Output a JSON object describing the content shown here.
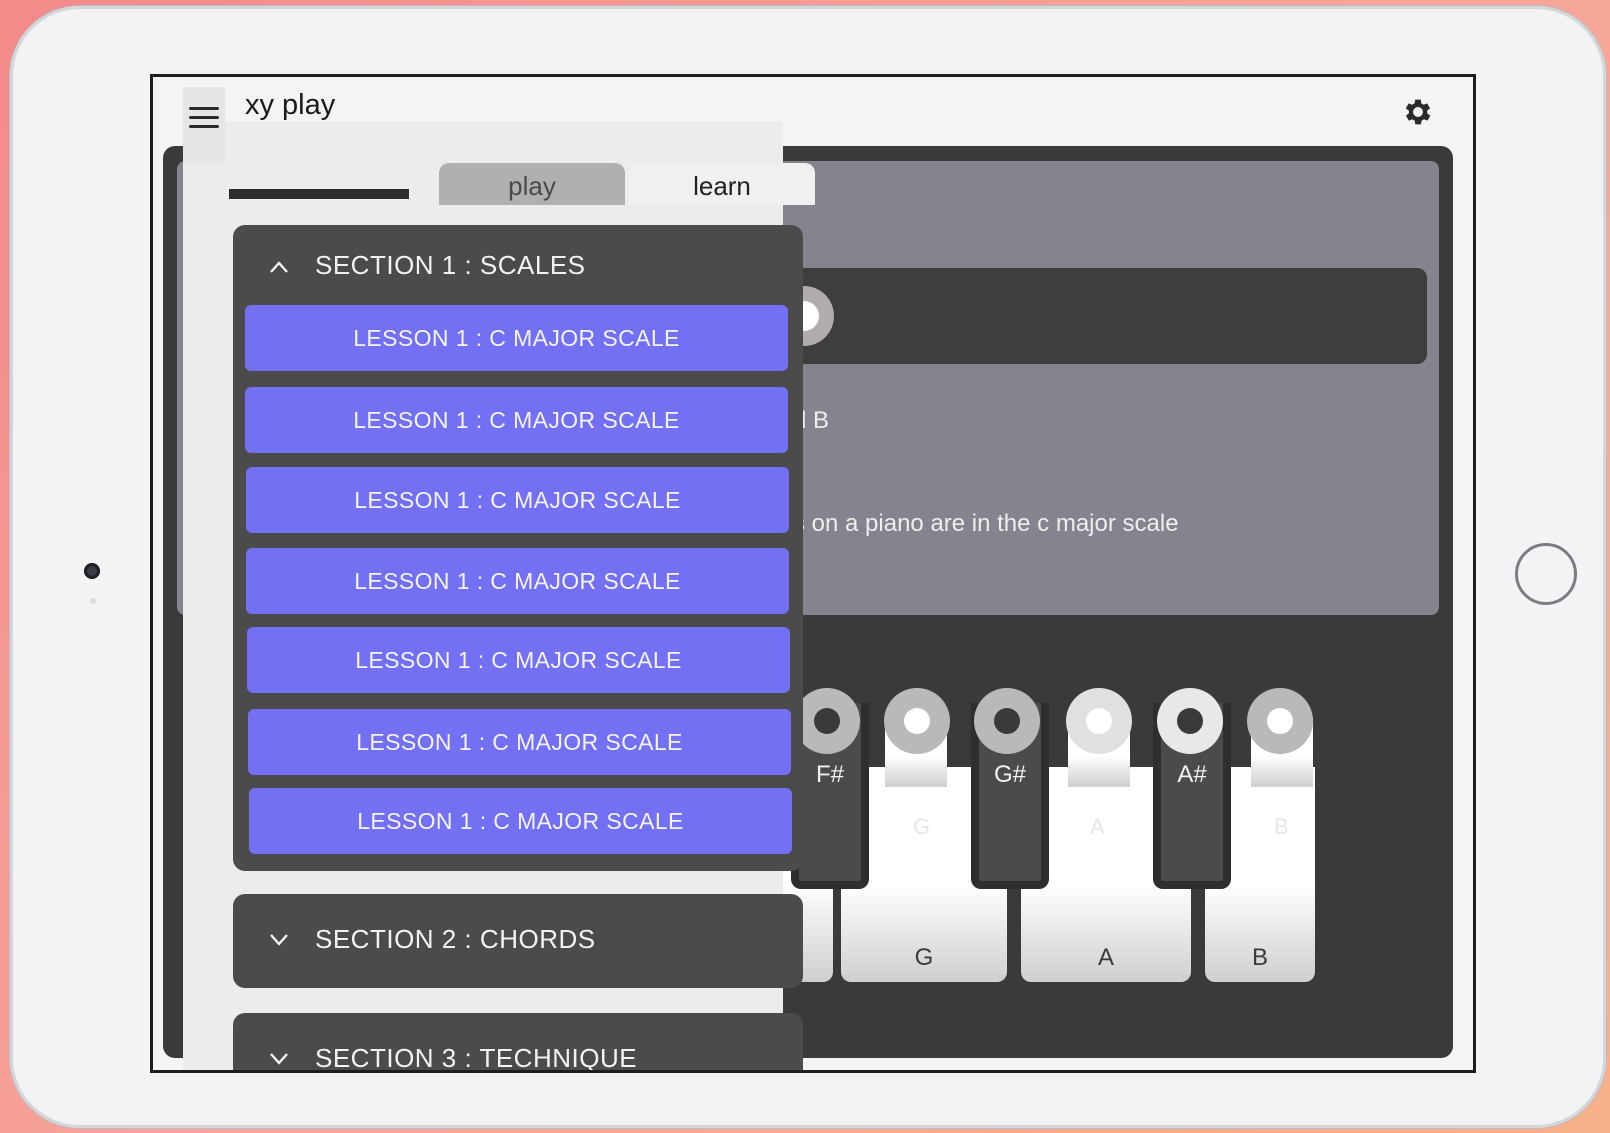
{
  "app": {
    "title": "xy play"
  },
  "tabs": [
    {
      "label": "play"
    },
    {
      "label": "learn"
    }
  ],
  "card": {
    "line1": "d B",
    "line2": "s on a piano are in the c major scale"
  },
  "keyboard": {
    "white_keys": [
      "G",
      "A",
      "B"
    ],
    "black_keys": [
      "F#",
      "G#",
      "A#"
    ],
    "ghost_labels": [
      "G",
      "A",
      "B"
    ]
  },
  "sections": [
    {
      "title": "SECTION 1  :  SCALES",
      "expanded": true,
      "lessons": [
        "LESSON 1  :  C MAJOR SCALE",
        "LESSON 1  :  C MAJOR SCALE",
        "LESSON 1  :  C MAJOR SCALE",
        "LESSON 1  :  C MAJOR SCALE",
        "LESSON 1  :  C MAJOR SCALE",
        "LESSON 1  :  C MAJOR SCALE",
        "LESSON 1  :  C MAJOR SCALE"
      ]
    },
    {
      "title": "SECTION 2  :  CHORDS",
      "expanded": false
    },
    {
      "title": "SECTION 3  :  TECHNIQUE",
      "expanded": false
    }
  ],
  "icons": {
    "menu": "hamburger-icon",
    "settings": "gear-icon",
    "expanded": "chevron-up-icon",
    "collapsed": "chevron-down-icon"
  },
  "colors": {
    "accent": "#7370f4",
    "section_bg": "#4b4b4b",
    "panel_bg": "#3a3a3a"
  }
}
